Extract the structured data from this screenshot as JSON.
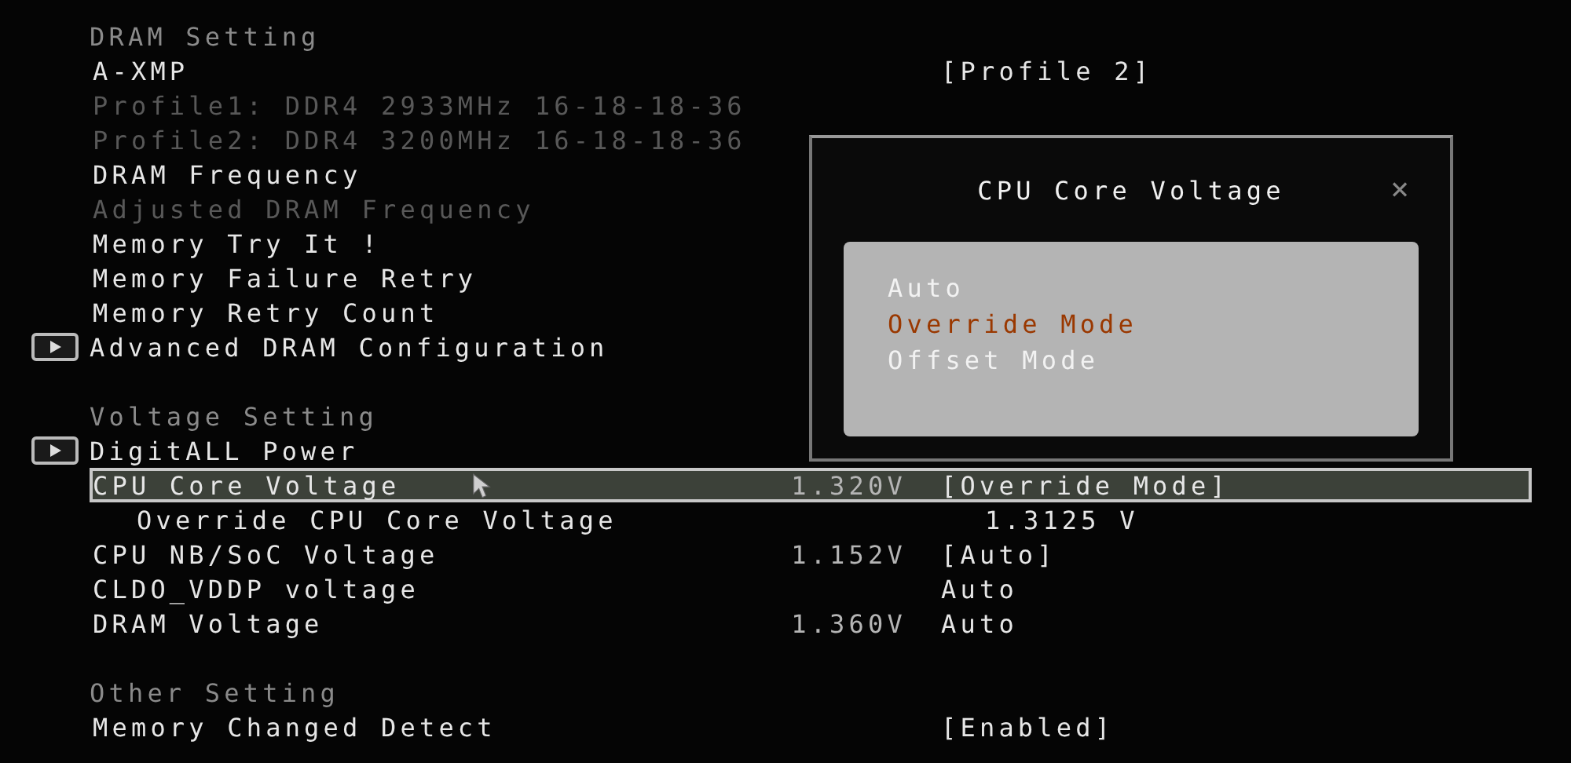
{
  "rows": [
    {
      "kind": "header",
      "label": "DRAM Setting"
    },
    {
      "kind": "item",
      "label": "A-XMP",
      "value": "[Profile 2]",
      "disabled": false,
      "selected": false
    },
    {
      "kind": "item",
      "label": "Profile1: DDR4 2933MHz 16-18-18-36",
      "disabled": true,
      "selected": false
    },
    {
      "kind": "item",
      "label": "Profile2: DDR4 3200MHz 16-18-18-36",
      "disabled": true,
      "selected": false
    },
    {
      "kind": "item",
      "label": "DRAM Frequency",
      "disabled": false,
      "selected": false
    },
    {
      "kind": "item",
      "label": "Adjusted DRAM Frequency",
      "disabled": true,
      "selected": false
    },
    {
      "kind": "item",
      "label": "Memory Try It !",
      "disabled": false,
      "selected": false
    },
    {
      "kind": "item",
      "label": "Memory Failure Retry",
      "disabled": false,
      "selected": false
    },
    {
      "kind": "item",
      "label": "Memory Retry Count",
      "disabled": false,
      "selected": false
    },
    {
      "kind": "submenu",
      "label": "Advanced DRAM Configuration"
    },
    {
      "kind": "spacer"
    },
    {
      "kind": "header",
      "label": "Voltage Setting"
    },
    {
      "kind": "submenu",
      "label": "DigitALL Power"
    },
    {
      "kind": "item",
      "label": "CPU Core Voltage",
      "reading": "1.320V",
      "value": "[Override Mode]",
      "disabled": false,
      "selected": true
    },
    {
      "kind": "subitem",
      "label": "Override CPU Core Voltage",
      "value": "1.3125 V",
      "disabled": false,
      "selected": false
    },
    {
      "kind": "item",
      "label": "CPU NB/SoC Voltage",
      "reading": "1.152V",
      "value": "[Auto]",
      "disabled": false,
      "selected": false
    },
    {
      "kind": "item",
      "label": "CLDO_VDDP voltage",
      "value": "Auto",
      "disabled": false,
      "selected": false
    },
    {
      "kind": "item",
      "label": "DRAM Voltage",
      "reading": "1.360V",
      "value": "Auto",
      "disabled": false,
      "selected": false
    },
    {
      "kind": "spacer"
    },
    {
      "kind": "header",
      "label": "Other Setting"
    },
    {
      "kind": "item",
      "label": "Memory Changed Detect",
      "value": "[Enabled]",
      "disabled": false,
      "selected": false
    }
  ],
  "dialog": {
    "title": "CPU Core Voltage",
    "close": "×",
    "options": [
      {
        "label": "Auto",
        "selected": false
      },
      {
        "label": "Override Mode",
        "selected": true
      },
      {
        "label": "Offset Mode",
        "selected": false
      }
    ]
  }
}
